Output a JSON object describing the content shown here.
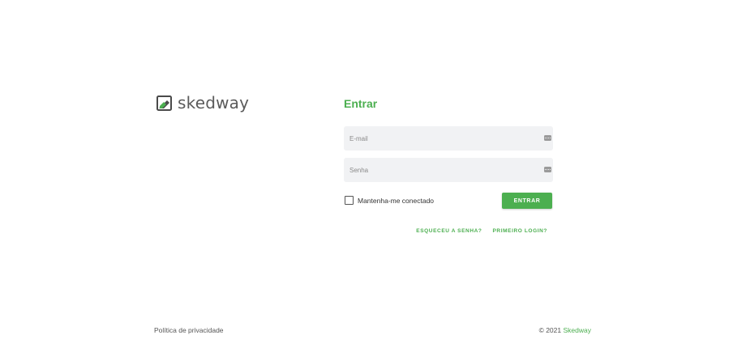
{
  "brand": {
    "name": "skedway",
    "icon": "skedway-logo-icon",
    "accent_color": "#4caf50"
  },
  "login": {
    "title": "Entrar",
    "email_placeholder": "E-mail",
    "password_placeholder": "Senha",
    "field_icon": "password-manager-icon",
    "remember_label": "Mantenha-me conectado",
    "submit_label": "ENTRAR",
    "forgot_password_label": "ESQUECEU A SENHA?",
    "first_login_label": "PRIMEIRO LOGIN?"
  },
  "footer": {
    "privacy_label": "Política de privacidade",
    "copyright_prefix": "© 2021",
    "copyright_brand": "Skedway"
  }
}
